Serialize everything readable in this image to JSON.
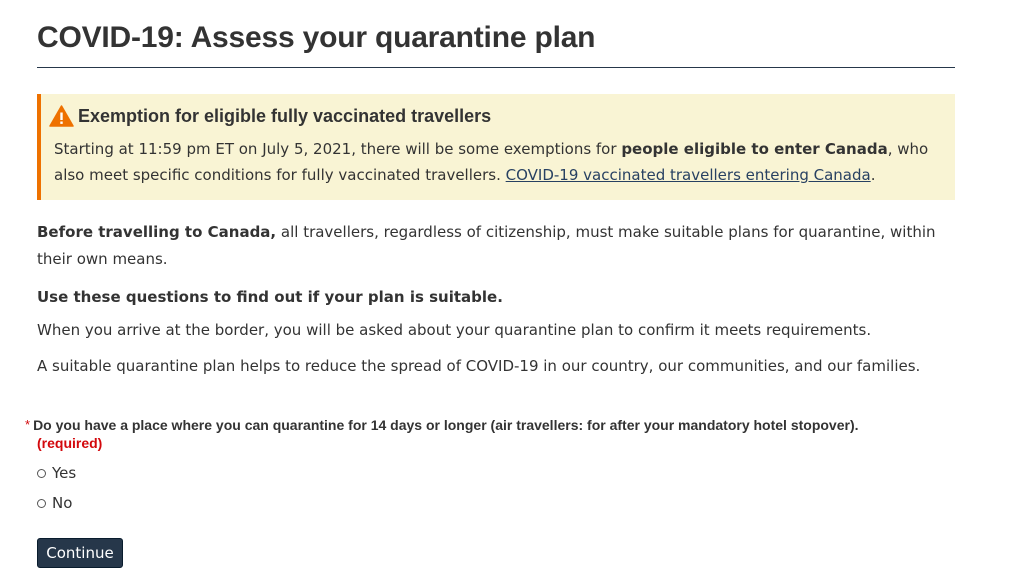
{
  "page": {
    "title": "COVID-19: Assess your quarantine plan"
  },
  "alert": {
    "icon": "warning-triangle-icon",
    "icon_color": "#ee7100",
    "background": "#f9f4d4",
    "heading": "Exemption for eligible fully vaccinated travellers",
    "body_prefix": "Starting at 11:59 pm ET on July 5, 2021, there will be some exemptions for ",
    "body_bold": "people eligible to enter Canada",
    "body_middle": ", who also meet specific conditions for fully vaccinated travellers. ",
    "link_text": "COVID-19 vaccinated travellers entering Canada",
    "body_suffix": "."
  },
  "content": {
    "p1_bold": "Before travelling to Canada,",
    "p1_rest": " all travellers, regardless of citizenship, must make suitable plans for quarantine, within their own means.",
    "p2": "Use these questions to find out if your plan is suitable.",
    "p3": "When you arrive at the border, you will be asked about your quarantine plan to confirm it meets requirements.",
    "p4": "A suitable quarantine plan helps to reduce the spread of COVID-19 in our country, our communities, and our families."
  },
  "question": {
    "asterisk": "*",
    "text": "Do you have a place where you can quarantine for 14 days or longer (air travellers: for after your mandatory hotel stopover).",
    "required_label": "(required)",
    "options": [
      {
        "label": "Yes",
        "selected": false
      },
      {
        "label": "No",
        "selected": false
      }
    ]
  },
  "actions": {
    "continue_label": "Continue",
    "button_color": "#26374a"
  }
}
